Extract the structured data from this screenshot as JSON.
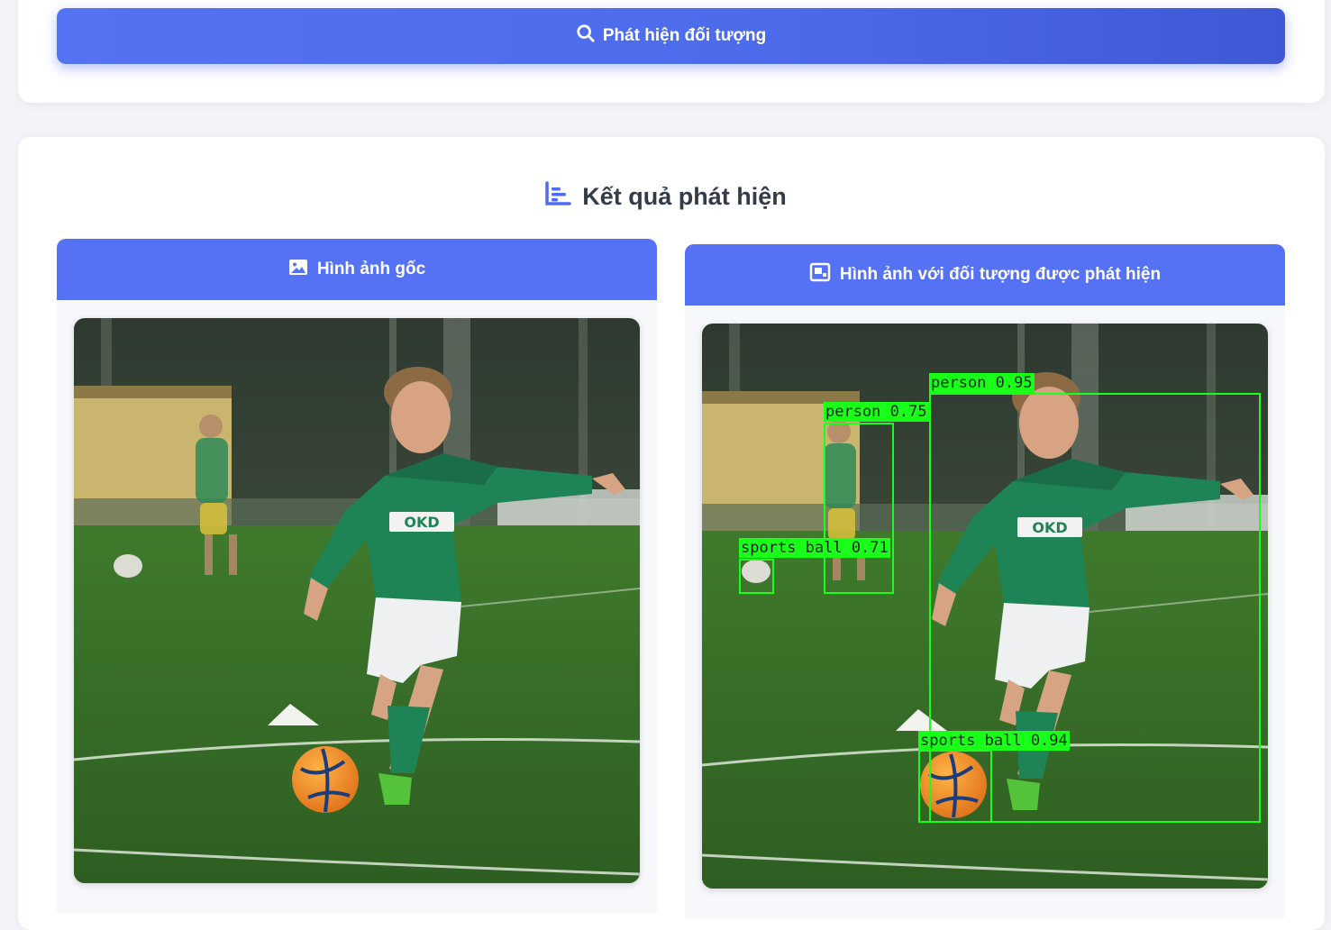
{
  "actions": {
    "detect_label": "Phát hiện đối tượng",
    "detect_icon": "search-icon"
  },
  "results": {
    "title": "Kết quả phát hiện",
    "title_icon": "chart-bars-icon",
    "original_panel": {
      "header": "Hình ảnh gốc",
      "icon": "image-icon"
    },
    "detected_panel": {
      "header": "Hình ảnh với đối tượng được phát hiện",
      "icon": "object-frame-icon",
      "detections": [
        {
          "label": "person 0.95"
        },
        {
          "label": "person 0.75"
        },
        {
          "label": "sports ball 0.71"
        },
        {
          "label": "sports ball 0.94"
        }
      ]
    }
  },
  "colors": {
    "accent": "#5571f4",
    "detection": "#19ff19",
    "title_text": "#333a48"
  }
}
